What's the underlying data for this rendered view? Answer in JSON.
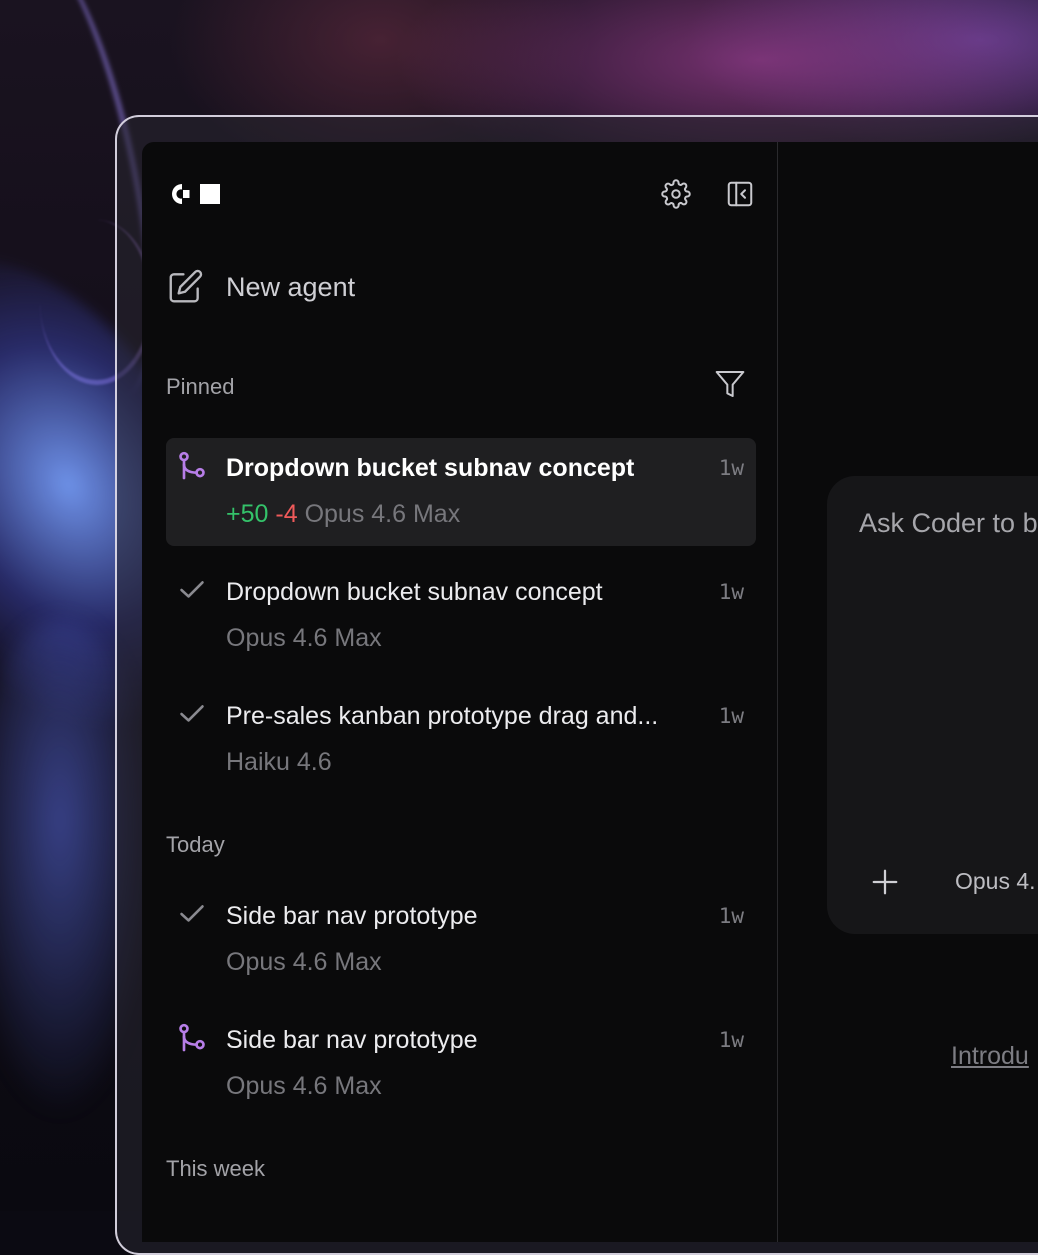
{
  "sidebar": {
    "new_agent_label": "New agent",
    "sections": {
      "pinned": "Pinned",
      "today": "Today",
      "this_week": "This week"
    },
    "pinned_items": [
      {
        "title": "Dropdown bucket subnav concept",
        "additions": "+50",
        "deletions": "-4",
        "model": "Opus 4.6 Max",
        "time": "1w",
        "status_icon": "branch-icon",
        "selected": true
      },
      {
        "title": "Dropdown bucket subnav concept",
        "model": "Opus 4.6 Max",
        "time": "1w",
        "status_icon": "check-icon"
      },
      {
        "title": "Pre-sales kanban prototype drag and...",
        "model": "Haiku 4.6",
        "time": "1w",
        "status_icon": "check-icon"
      }
    ],
    "today_items": [
      {
        "title": "Side bar nav prototype",
        "model": "Opus 4.6 Max",
        "time": "1w",
        "status_icon": "check-icon"
      },
      {
        "title": "Side bar nav prototype",
        "model": "Opus 4.6 Max",
        "time": "1w",
        "status_icon": "branch-icon"
      }
    ]
  },
  "main": {
    "composer_placeholder": "Ask Coder to b",
    "model_select": "Opus 4.",
    "intro_link": "Introdu"
  },
  "colors": {
    "accent_purple": "#b77ee8",
    "additions_green": "#34c26a",
    "deletions_red": "#ef5a5a"
  }
}
